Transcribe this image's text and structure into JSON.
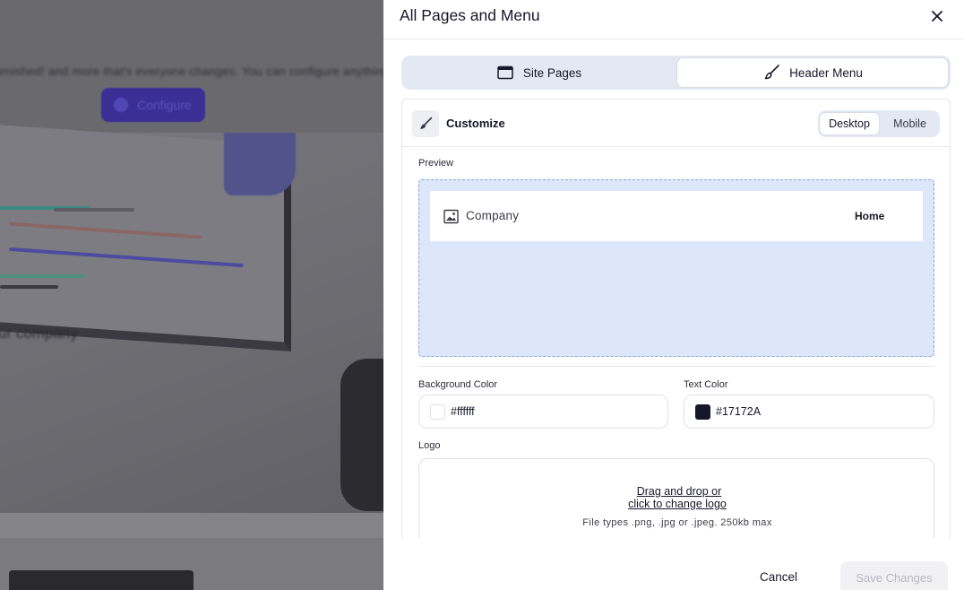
{
  "backdrop": {
    "blurred_text": "furnished! and more that's everyone changes. You can configure anything",
    "configure_label": "Configure",
    "image_caption": "ur company"
  },
  "drawer": {
    "title": "All Pages and Menu",
    "close_icon": "close-icon"
  },
  "tabs": [
    {
      "label": "Site Pages",
      "icon": "browser-window-icon",
      "active": false
    },
    {
      "label": "Header Menu",
      "icon": "paintbrush-icon",
      "active": true
    }
  ],
  "customize": {
    "label": "Customize",
    "icon": "paintbrush-icon",
    "view_modes": [
      "Desktop",
      "Mobile"
    ],
    "selected_view": "Desktop"
  },
  "preview": {
    "label": "Preview",
    "company_name": "Company",
    "nav_link": "Home",
    "logo_placeholder_icon": "image-icon"
  },
  "background_color": {
    "label": "Background Color",
    "value": "#ffffff"
  },
  "text_color": {
    "label": "Text Color",
    "value": "#17172A"
  },
  "logo": {
    "label": "Logo",
    "link_line1": "Drag and drop or",
    "link_line2": "click to change logo",
    "hint": "File types .png, .jpg or .jpeg. 250kb max"
  },
  "footer": {
    "cancel_label": "Cancel",
    "save_label": "Save Changes"
  },
  "colors": {
    "accent_tab_bg": "#e4e8f3",
    "preview_bg": "#dde7fb",
    "text_primary": "#17172A",
    "configure_button": "#3b2f96"
  }
}
